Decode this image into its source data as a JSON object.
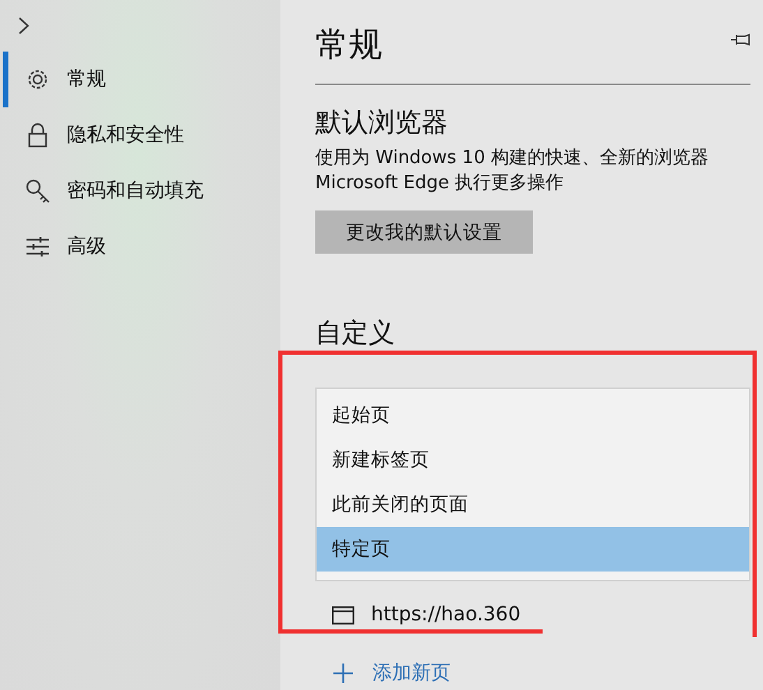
{
  "sidebar": {
    "items": [
      {
        "label": "常规",
        "selected": true
      },
      {
        "label": "隐私和安全性",
        "selected": false
      },
      {
        "label": "密码和自动填充",
        "selected": false
      },
      {
        "label": "高级",
        "selected": false
      }
    ]
  },
  "page": {
    "title": "常规",
    "default_browser": {
      "heading": "默认浏览器",
      "description": [
        "使用为 Windows 10 构建的快速、全新的浏览器",
        "Microsoft Edge 执行更多操作"
      ],
      "button": "更改我的默认设置"
    },
    "customize": {
      "heading": "自定义",
      "dropdown": {
        "options": [
          {
            "label": "起始页",
            "selected": false
          },
          {
            "label": "新建标签页",
            "selected": false
          },
          {
            "label": "此前关闭的页面",
            "selected": false
          },
          {
            "label": "特定页",
            "selected": true
          }
        ]
      },
      "pages": [
        "https://hao.360"
      ],
      "add_page": "添加新页"
    }
  }
}
